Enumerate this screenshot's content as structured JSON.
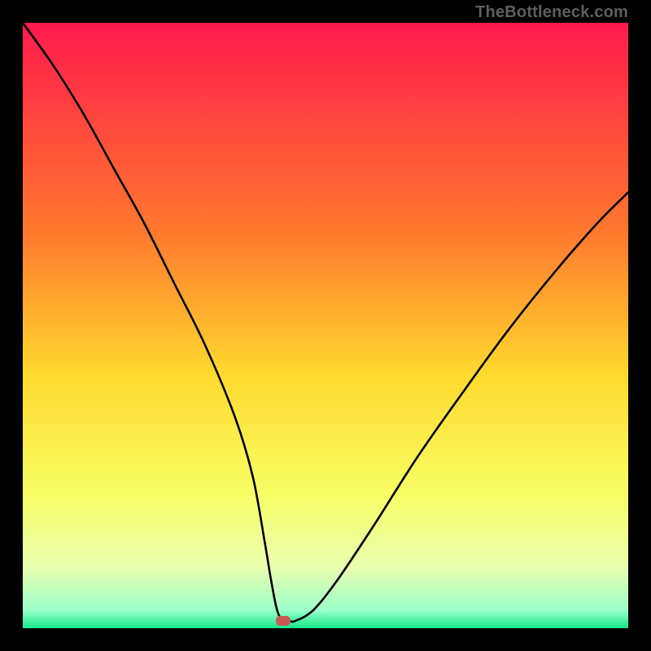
{
  "watermark": "TheBottleneck.com",
  "chart_data": {
    "type": "line",
    "title": "",
    "xlabel": "",
    "ylabel": "",
    "xlim": [
      0,
      100
    ],
    "ylim": [
      0,
      100
    ],
    "gradient_stops": [
      {
        "offset": 0,
        "color": "#ff1a4d"
      },
      {
        "offset": 0.35,
        "color": "#ff7a2e"
      },
      {
        "offset": 0.58,
        "color": "#ffd92e"
      },
      {
        "offset": 0.78,
        "color": "#f8ff66"
      },
      {
        "offset": 0.9,
        "color": "#eaffb0"
      },
      {
        "offset": 0.97,
        "color": "#9cffc8"
      },
      {
        "offset": 1.0,
        "color": "#16e889"
      }
    ],
    "series": [
      {
        "name": "bottleneck-curve",
        "x": [
          0,
          5,
          10,
          15,
          20,
          25,
          30,
          35,
          38,
          40,
          41,
          42,
          43,
          44,
          45,
          48,
          52,
          58,
          65,
          72,
          80,
          88,
          95,
          100
        ],
        "y": [
          100,
          93,
          85,
          76,
          67,
          57,
          47,
          35,
          25,
          14,
          8,
          3,
          1.2,
          1.2,
          1.2,
          3,
          8,
          17,
          28,
          38,
          49,
          59,
          67,
          72
        ]
      }
    ],
    "optimum_marker": {
      "x": 43,
      "y": 1.2
    }
  }
}
